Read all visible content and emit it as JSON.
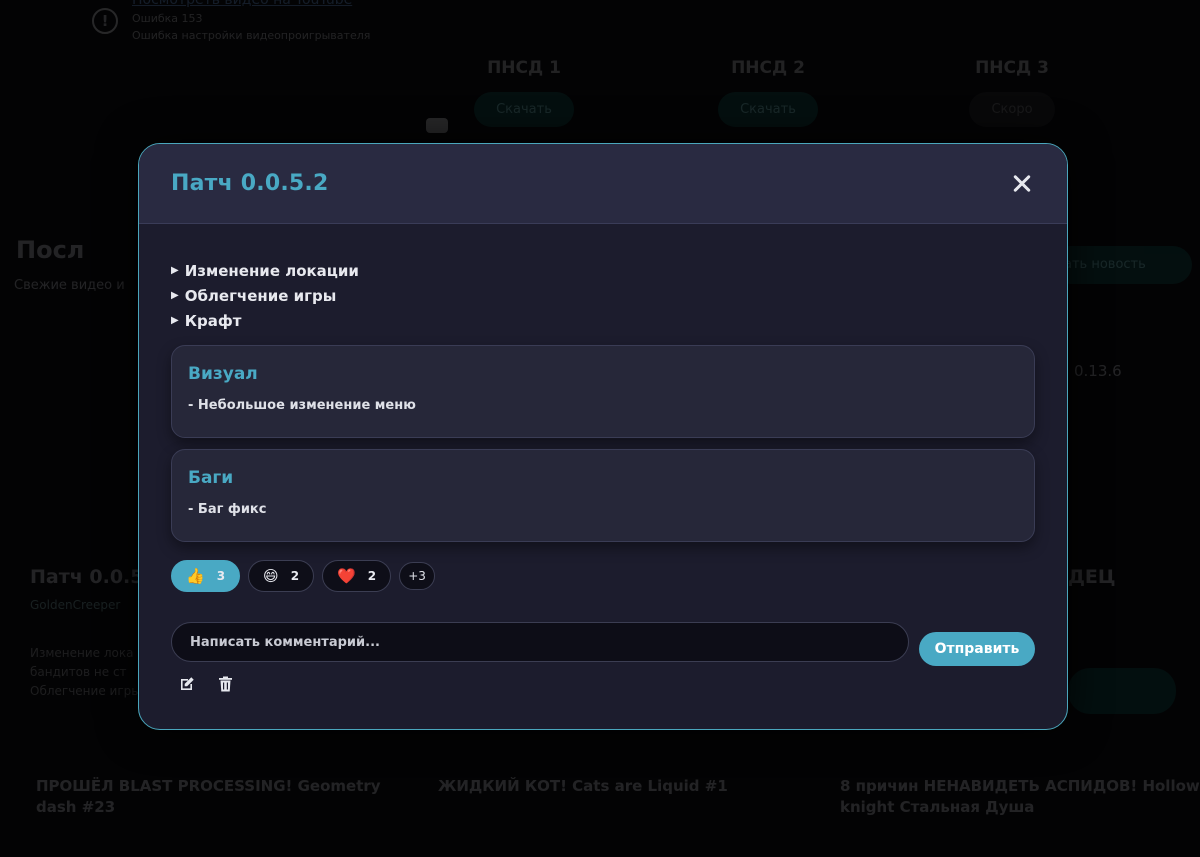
{
  "background": {
    "video_error": {
      "link": "Посмотреть видео на YouTube",
      "code": "Ошибка 153",
      "message": "Ошибка настройки видеопроигрывателя"
    },
    "columns": [
      {
        "title": "ПНСД 1",
        "button": "Скачать"
      },
      {
        "title": "ПНСД 2",
        "button": "Скачать"
      },
      {
        "title": "ПНСД 3",
        "button": "Скоро"
      }
    ],
    "news_title": "Посл",
    "news_subtitle": "Свежие видео и",
    "news_button": "ать новость",
    "version": "0.13.6",
    "card_title": "Патч 0.0.5",
    "card_author": "GoldenCreeper",
    "card_desc_1": "Изменение лока",
    "card_desc_2": "бандитов не ст",
    "card_desc_3": "Облегчение игры",
    "right_title": "ДЕЦ",
    "thumbs": [
      "ПРОШЁЛ BLAST PROCESSING! Geometry dash #23",
      "ЖИДКИЙ КОТ! Cats are Liquid #1",
      "8 причин НЕНАВИДЕТЬ АСПИДОВ! Hollow knight Стальная Душа"
    ]
  },
  "modal": {
    "title": "Патч 0.0.5.2",
    "toggles": [
      "Изменение локации",
      "Облегчение игры",
      "Крафт"
    ],
    "sections": [
      {
        "title": "Визуал",
        "items": [
          "- Небольшое изменение меню"
        ]
      },
      {
        "title": "Баги",
        "items": [
          "- Баг фикс"
        ]
      }
    ],
    "reactions": [
      {
        "emoji": "👍",
        "count": "3",
        "active": true
      },
      {
        "emoji": "😄",
        "count": "2",
        "active": false
      },
      {
        "emoji": "❤️",
        "count": "2",
        "active": false
      }
    ],
    "more_reactions": "+3",
    "comment_placeholder": "Написать комментарий...",
    "send_label": "Отправить"
  },
  "colors": {
    "accent": "#49a9c4",
    "modal_bg": "#1c1c2d",
    "header_bg": "#292a41"
  }
}
